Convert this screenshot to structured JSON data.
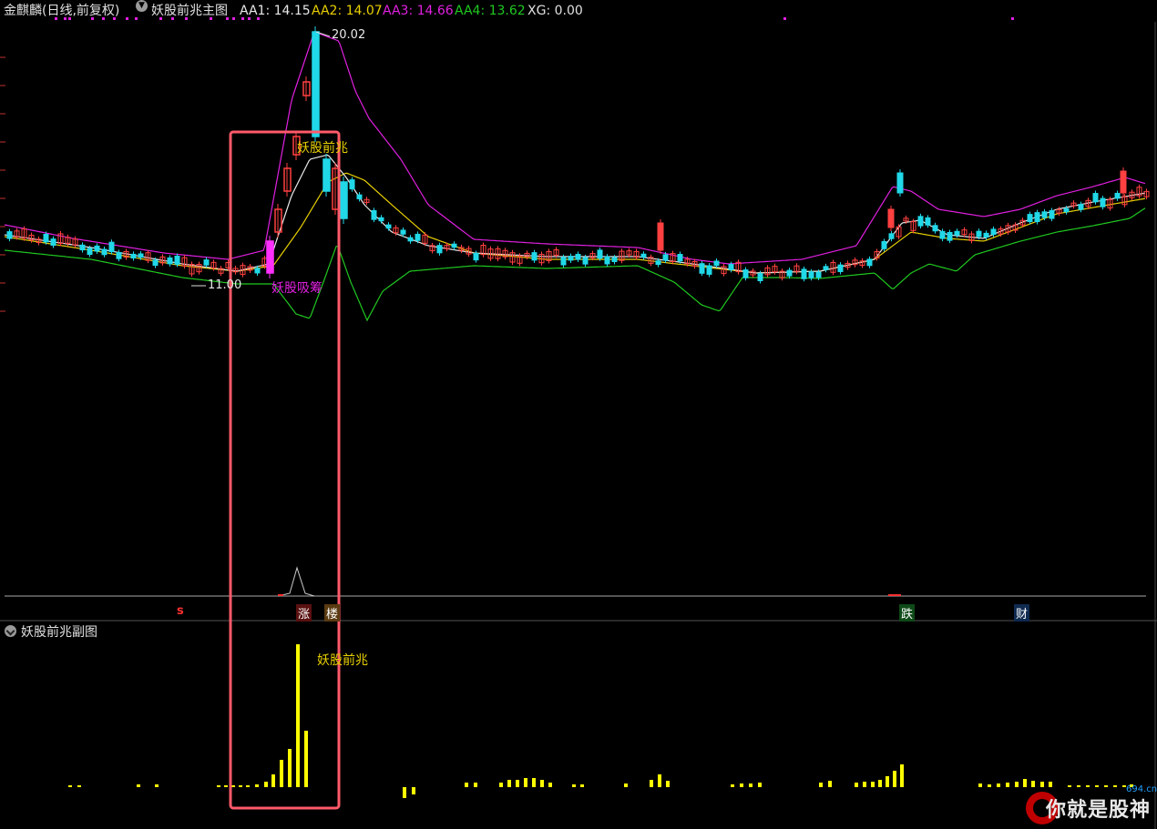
{
  "header": {
    "stock_name": "金麒麟(日线,前复权)",
    "indicator_name": "妖股前兆主图",
    "aa1_label": "AA1: 14.15",
    "aa2_label": "AA2: 14.07",
    "aa3_label": "AA3: 14.66",
    "aa4_label": "AA4: 13.62",
    "xg_label": "XG: 0.00"
  },
  "colors": {
    "aa1": "#e8e8e8",
    "aa2": "#e8d000",
    "aa3": "#e020e0",
    "aa4": "#20c820",
    "up": "#ff4040",
    "down": "#20d8e8",
    "box": "#ff5a6a",
    "sub_bar": "#ffff00"
  },
  "main_chart": {
    "high_label": "20.02",
    "low_label": "11.00",
    "signal_label": "妖股前兆",
    "absorb_label": "妖股吸筹"
  },
  "markers": {
    "s_marker": "s",
    "zhang": "涨",
    "lou": "楼",
    "die": "跌",
    "cai": "财"
  },
  "sub_chart": {
    "title": "妖股前兆副图",
    "signal_label": "妖股前兆"
  },
  "watermark": {
    "text": "你就是股神",
    "site": "694.cn"
  },
  "chart_data": {
    "type": "line",
    "series": [
      {
        "name": "AA1",
        "values": [
          14.15
        ]
      },
      {
        "name": "AA2",
        "values": [
          14.07
        ]
      },
      {
        "name": "AA3",
        "values": [
          14.66
        ]
      },
      {
        "name": "AA4",
        "values": [
          13.62
        ]
      }
    ],
    "annotations": [
      "20.02",
      "11.00",
      "妖股前兆",
      "妖股吸筹"
    ]
  }
}
